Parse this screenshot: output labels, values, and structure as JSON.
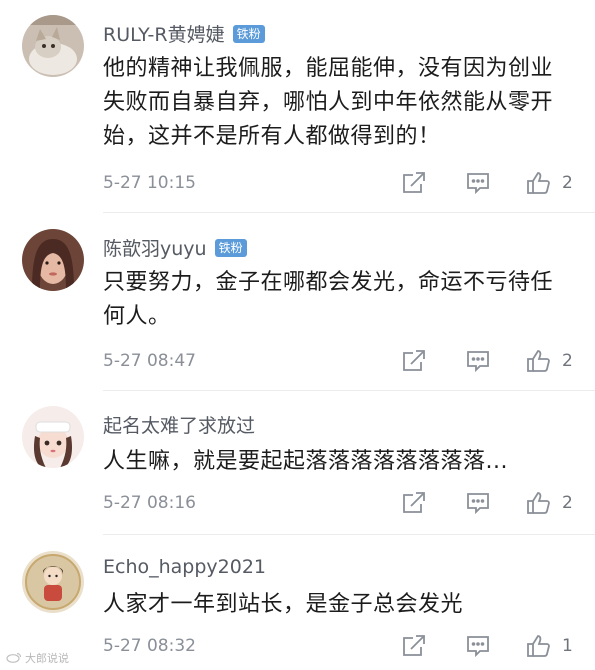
{
  "comments": [
    {
      "username": "RULY-R黄娉婕",
      "badge": "铁粉",
      "text": "他的精神让我佩服，能屈能伸，没有因为创业失败而自暴自弃，哪怕人到中年依然能从零开始，这并不是所有人都做得到的！",
      "timestamp": "5-27 10:15",
      "likes": "2",
      "avatar_icon": "cat-photo-avatar",
      "avatar_color": "#c9b8a8"
    },
    {
      "username": "陈歆羽yuyu",
      "badge": "铁粉",
      "text": "只要努力，金子在哪都会发光，命运不亏待任何人。",
      "timestamp": "5-27 08:47",
      "likes": "2",
      "avatar_icon": "girl-photo-avatar",
      "avatar_color": "#7a4a3a"
    },
    {
      "username": "起名太难了求放过",
      "badge": "",
      "text": "人生嘛，就是要起起落落落落落落落落...",
      "timestamp": "5-27 08:16",
      "likes": "2",
      "avatar_icon": "cartoon-girl-avatar",
      "avatar_color": "#f3e6e4"
    },
    {
      "username": "Echo_happy2021",
      "badge": "",
      "text": "人家才一年到站长，是金子总会发光",
      "timestamp": "5-27 08:32",
      "likes": "1",
      "avatar_icon": "cartoon-figure-avatar",
      "avatar_color": "#e7d9c2"
    }
  ],
  "watermark": {
    "text": "大郎说说",
    "icon": "weibo-icon"
  }
}
